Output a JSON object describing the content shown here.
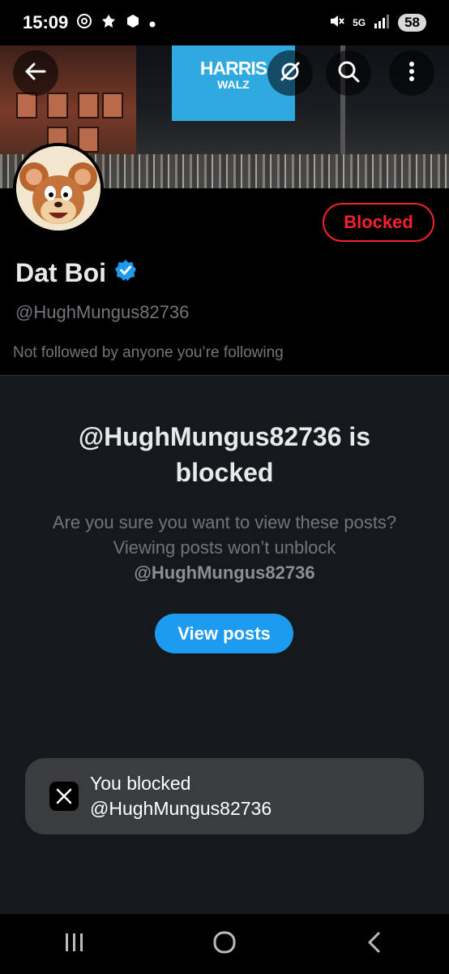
{
  "status_bar": {
    "time": "15:09",
    "network": "5G",
    "battery": "58"
  },
  "banner": {
    "screen_line1": "HARRIS",
    "screen_line2": "WALZ"
  },
  "profile": {
    "display_name": "Dat Boi",
    "handle": "@HughMungus82736",
    "followed_by": "Not followed by anyone you’re following",
    "blocked_button": "Blocked",
    "verified": true
  },
  "blocked_notice": {
    "title": "@HughMungus82736 is blocked",
    "description": "Are you sure you want to view these posts? Viewing posts won’t unblock",
    "description_handle": "@HughMungus82736",
    "view_button": "View posts"
  },
  "toast": {
    "line1": "You blocked",
    "line2": "@HughMungus82736"
  },
  "colors": {
    "accent": "#1d9bf0",
    "blocked_red": "#f4212e",
    "background": "#15181c",
    "secondary_text": "#71767b"
  },
  "icons": {
    "back": "back-arrow-icon",
    "grok": "grok-icon",
    "search": "search-icon",
    "more": "more-vertical-icon",
    "verified": "verified-badge-icon",
    "x_logo": "x-logo-icon",
    "nav_recents": "recents-icon",
    "nav_home": "home-icon",
    "nav_back": "nav-back-icon"
  }
}
